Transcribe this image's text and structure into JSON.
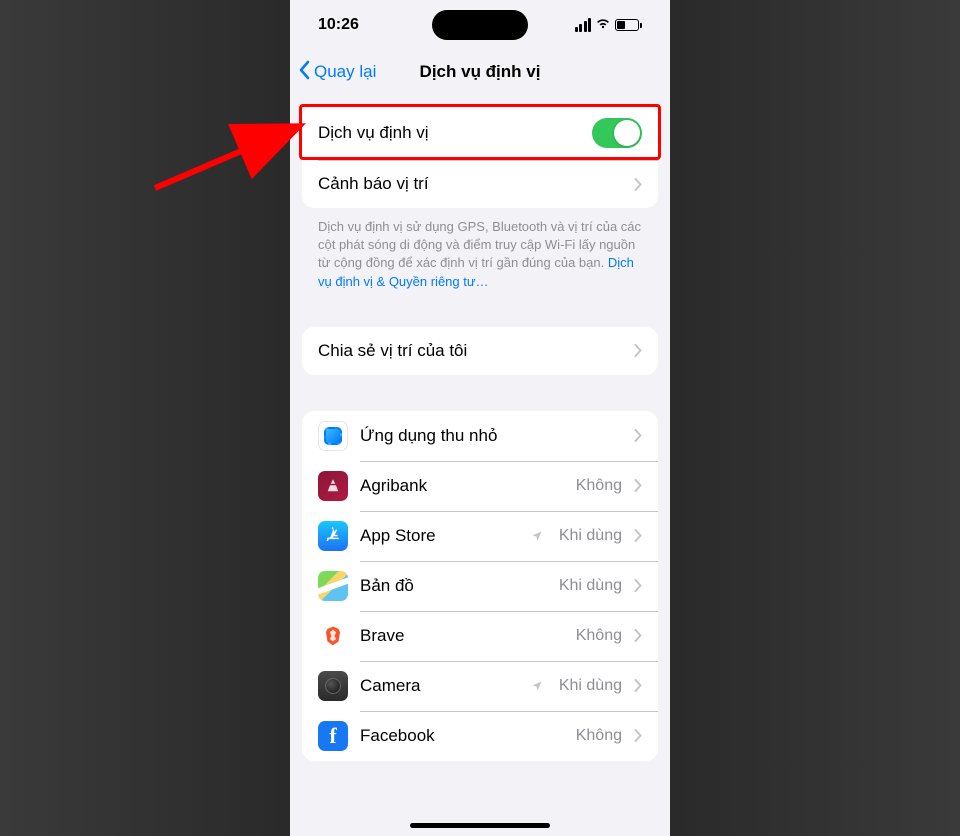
{
  "status": {
    "time": "10:26"
  },
  "nav": {
    "back": "Quay lại",
    "title": "Dịch vụ định vị"
  },
  "section1": {
    "location_services_label": "Dịch vụ định vị",
    "location_alerts_label": "Cảnh báo vị trí"
  },
  "footer": {
    "text": "Dịch vụ định vị sử dụng GPS, Bluetooth và vị trí của các cột phát sóng di động và điểm truy cập Wi-Fi lấy nguồn từ cộng đồng để xác định vị trí gần đúng của bạn. ",
    "link": "Dịch vụ định vị & Quyền riêng tư…"
  },
  "share": {
    "label": "Chia sẻ vị trí của tôi"
  },
  "apps": [
    {
      "name": "Ứng dụng thu nhỏ",
      "value": "",
      "arrow": false,
      "icon": "appclips"
    },
    {
      "name": "Agribank",
      "value": "Không",
      "arrow": false,
      "icon": "agribank"
    },
    {
      "name": "App Store",
      "value": "Khi dùng",
      "arrow": true,
      "icon": "appstore"
    },
    {
      "name": "Bản đồ",
      "value": "Khi dùng",
      "arrow": false,
      "icon": "maps"
    },
    {
      "name": "Brave",
      "value": "Không",
      "arrow": false,
      "icon": "brave"
    },
    {
      "name": "Camera",
      "value": "Khi dùng",
      "arrow": true,
      "icon": "camera"
    },
    {
      "name": "Facebook",
      "value": "Không",
      "arrow": false,
      "icon": "facebook"
    }
  ],
  "values": {
    "none": "Không",
    "while_using": "Khi dùng"
  }
}
